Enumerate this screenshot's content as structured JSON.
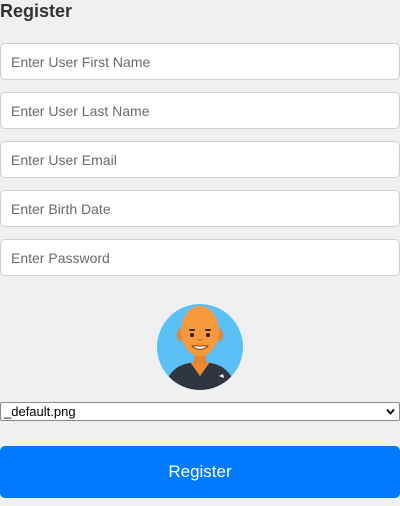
{
  "form": {
    "title": "Register",
    "fields": [
      {
        "placeholder": "Enter User First Name",
        "value": ""
      },
      {
        "placeholder": "Enter User Last Name",
        "value": ""
      },
      {
        "placeholder": "Enter User Email",
        "value": ""
      },
      {
        "placeholder": "Enter Birth Date",
        "value": ""
      },
      {
        "placeholder": "Enter Password",
        "value": ""
      }
    ],
    "avatar": {
      "icon": "default-avatar-icon"
    },
    "image_select": {
      "selected": "_default.png"
    },
    "submit_label": "Register"
  },
  "colors": {
    "background": "#f0f0f0",
    "button": "#007bff",
    "avatar_bg": "#5bc0f5",
    "avatar_skin": "#f79a3e"
  }
}
